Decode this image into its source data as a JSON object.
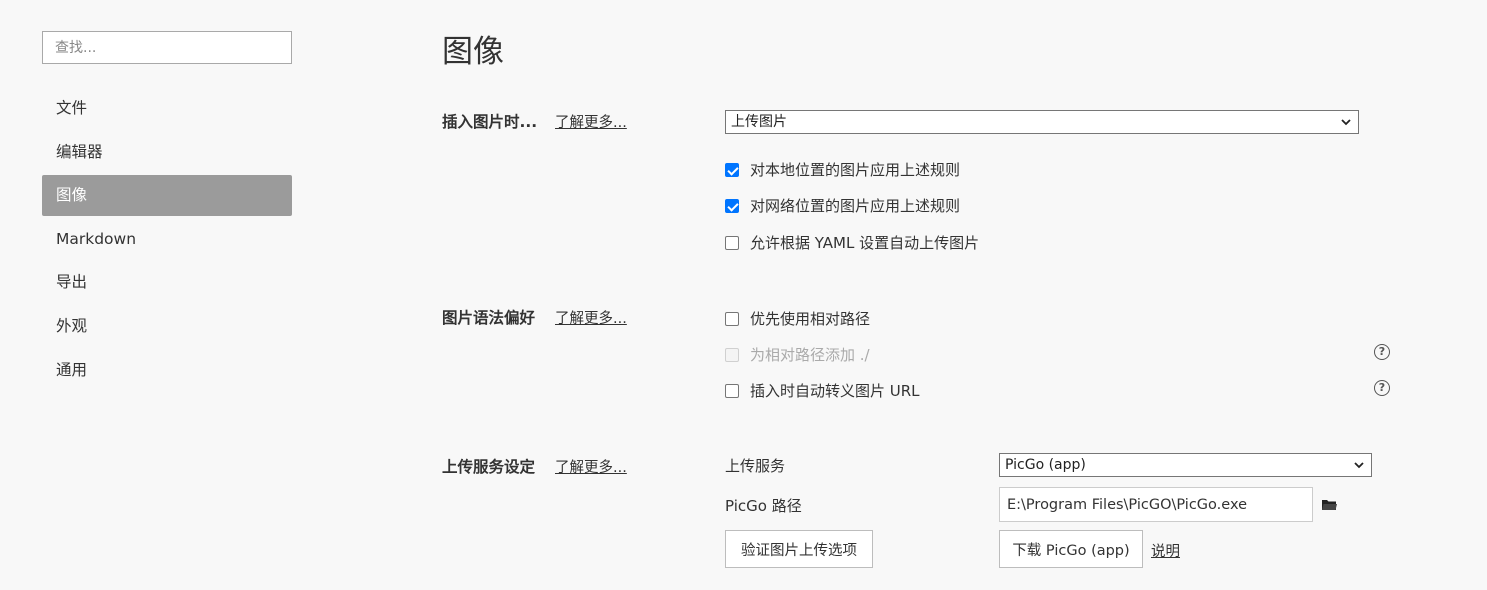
{
  "sidebar": {
    "search_placeholder": "查找...",
    "items": [
      {
        "label": "文件"
      },
      {
        "label": "编辑器"
      },
      {
        "label": "图像",
        "active": true
      },
      {
        "label": "Markdown"
      },
      {
        "label": "导出"
      },
      {
        "label": "外观"
      },
      {
        "label": "通用"
      }
    ]
  },
  "main": {
    "title": "图像",
    "learn_more": "了解更多...",
    "insert": {
      "label": "插入图片时...",
      "select_value": "上传图片",
      "options": [
        {
          "label": "对本地位置的图片应用上述规则",
          "checked": true
        },
        {
          "label": "对网络位置的图片应用上述规则",
          "checked": true
        },
        {
          "label": "允许根据 YAML 设置自动上传图片",
          "checked": false
        }
      ]
    },
    "syntax": {
      "label": "图片语法偏好",
      "options": [
        {
          "label": "优先使用相对路径",
          "checked": false
        },
        {
          "label": "为相对路径添加 ./",
          "checked": false,
          "disabled": true
        },
        {
          "label": "插入时自动转义图片 URL",
          "checked": false
        }
      ],
      "help_icon": "?"
    },
    "upload": {
      "label": "上传服务设定",
      "service_label": "上传服务",
      "service_value": "PicGo (app)",
      "path_label": "PicGo 路径",
      "path_value": "E:\\Program Files\\PicGO\\PicGo.exe",
      "verify_button": "验证图片上传选项",
      "download_button": "下载 PicGo (app)",
      "help_link": "说明"
    }
  },
  "colors": {
    "accent": "#0075ff",
    "active_nav": "#9b9b9b",
    "background": "#f8f8f8"
  }
}
